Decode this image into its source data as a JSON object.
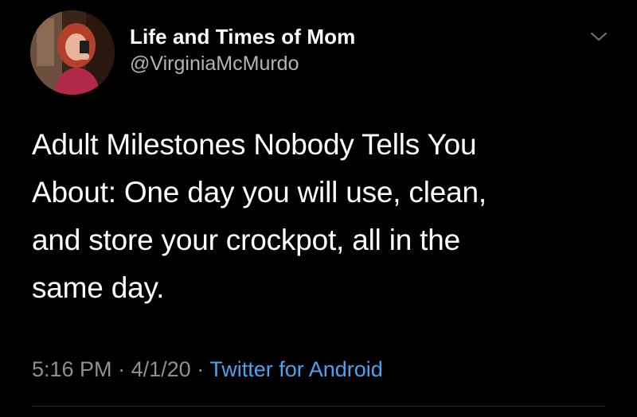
{
  "author": {
    "display_name": "Life and Times of Mom",
    "handle": "@VirginiaMcMurdo",
    "avatar_icon": "profile-photo"
  },
  "tweet": {
    "text": "Adult Milestones Nobody Tells You\nAbout: One day you will use, clean,\nand store your crockpot, all in the\nsame day."
  },
  "meta": {
    "time": "5:16 PM",
    "separator": "·",
    "date": "4/1/20",
    "source": "Twitter for Android"
  },
  "menu": {
    "icon": "chevron-down-icon"
  },
  "colors": {
    "background": "#000000",
    "text": "#ffffff",
    "secondary": "#8c9197",
    "link": "#4aa3ee"
  }
}
